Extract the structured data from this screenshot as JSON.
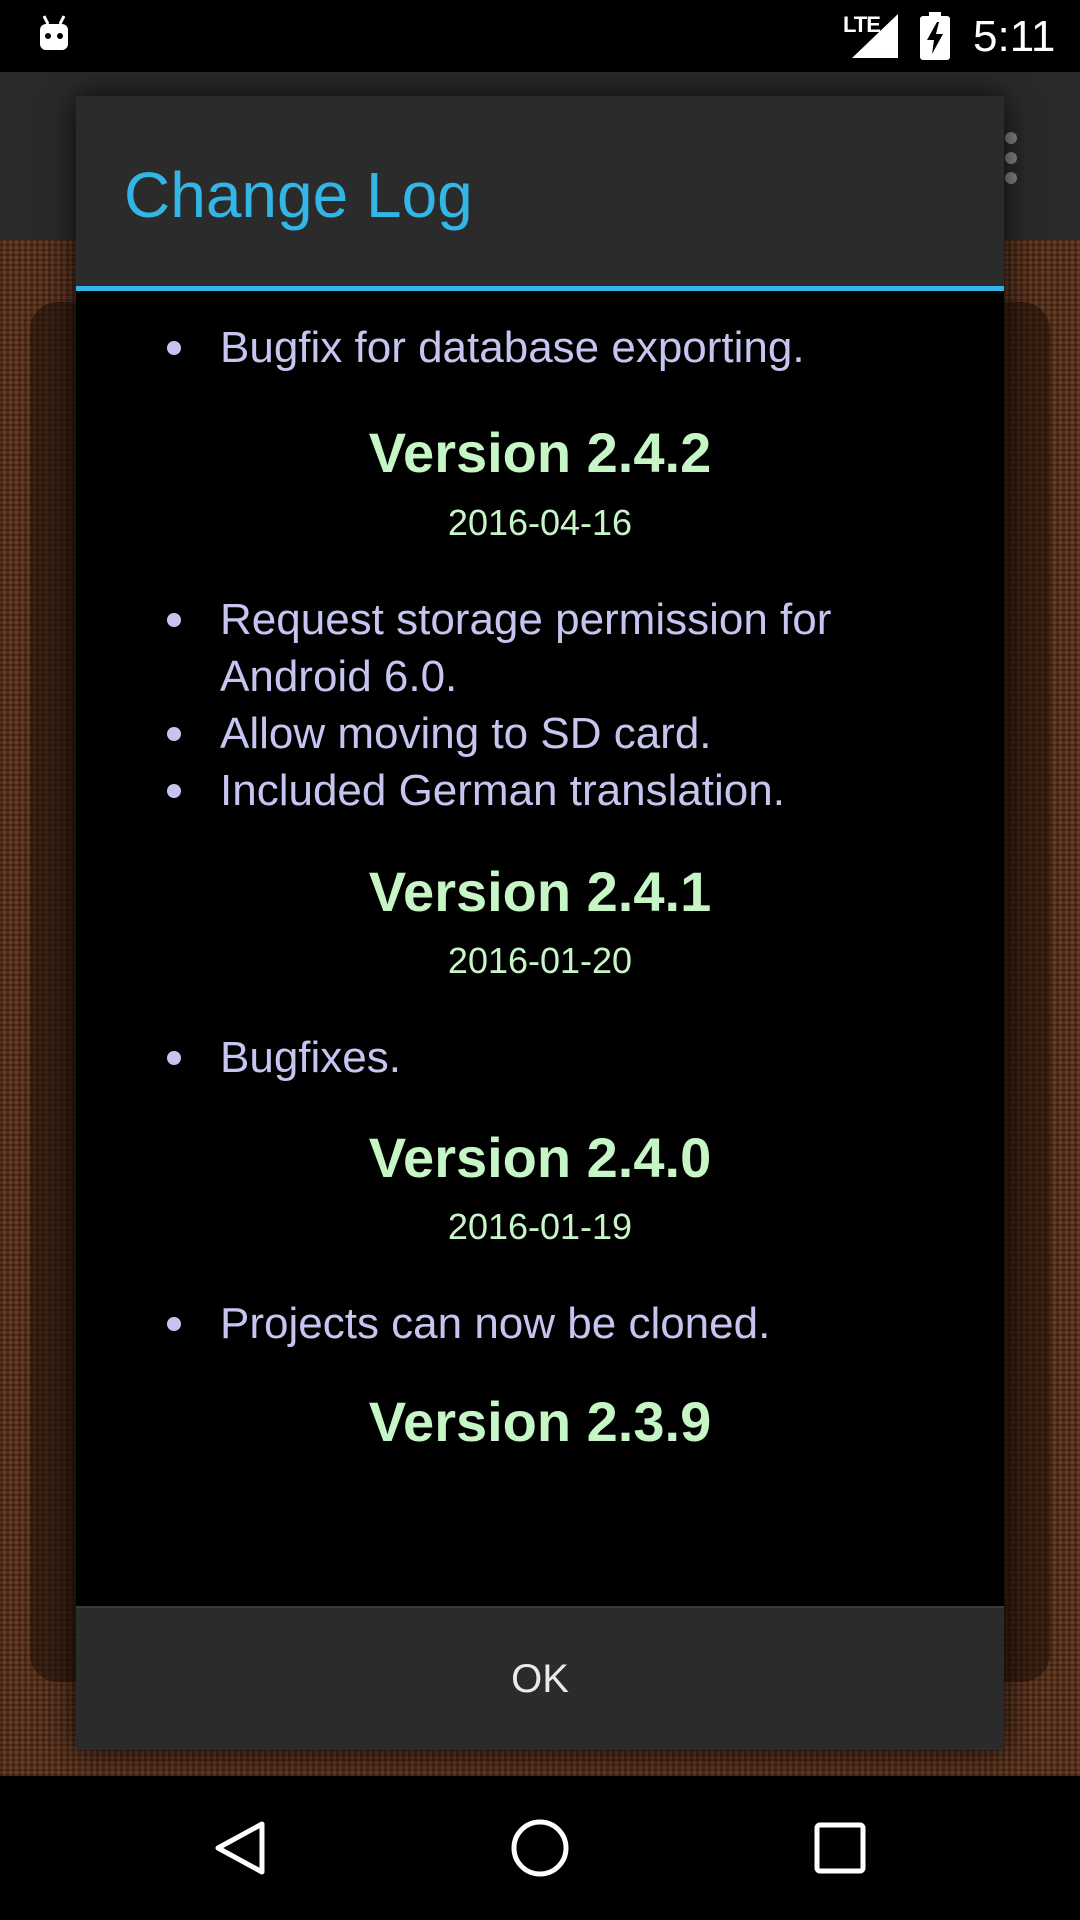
{
  "status_bar": {
    "time": "5:11",
    "network_label": "LTE",
    "icons": [
      "android-notification-icon",
      "signal-icon",
      "battery-charging-icon"
    ]
  },
  "dialog": {
    "title": "Change Log",
    "entries": [
      {
        "items": [
          "Bugfix for database exporting."
        ]
      },
      {
        "version": "Version 2.4.2",
        "date": "2016-04-16",
        "items": [
          "Request storage permission for Android 6.0.",
          "Allow moving to SD card.",
          "Included German translation."
        ]
      },
      {
        "version": "Version 2.4.1",
        "date": "2016-01-20",
        "items": [
          "Bugfixes."
        ]
      },
      {
        "version": "Version 2.4.0",
        "date": "2016-01-19",
        "items": [
          "Projects can now be cloned."
        ]
      },
      {
        "version": "Version 2.3.9"
      }
    ],
    "ok_label": "OK"
  },
  "nav_bar": {
    "icons": [
      "back-icon",
      "home-icon",
      "recents-icon"
    ]
  },
  "colors": {
    "accent": "#33b5e5",
    "bullet_text": "#c5c5f0",
    "version_text": "#c6f5c6",
    "dialog_chrome": "#2b2b2b"
  }
}
